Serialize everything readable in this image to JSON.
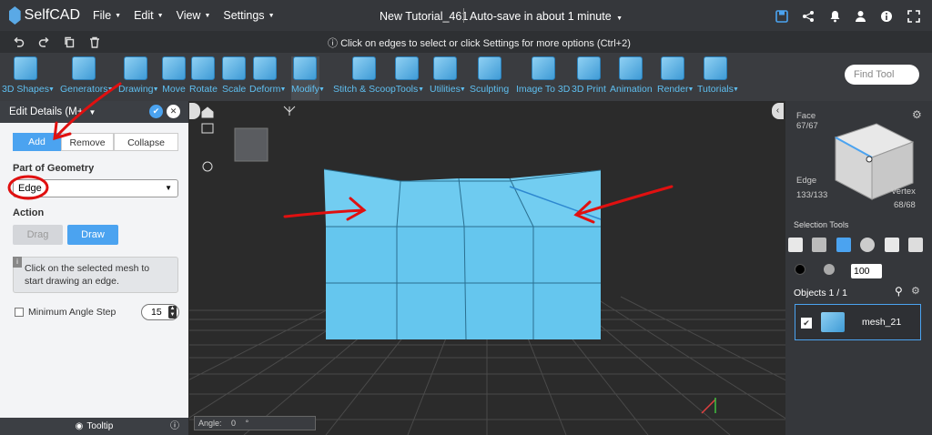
{
  "app": {
    "name": "SelfCAD",
    "brand_color": "#5aa9e6"
  },
  "menu": {
    "file": "File",
    "edit": "Edit",
    "view": "View",
    "settings": "Settings"
  },
  "document": {
    "title": "New Tutorial_461",
    "autosave": "Auto-save in about 1 minute"
  },
  "hint": "Click on edges to select or click Settings for more options (Ctrl+2)",
  "toolbar": [
    {
      "label": "3D Shapes"
    },
    {
      "label": "Generators"
    },
    {
      "label": "Drawing"
    },
    {
      "label": "Move"
    },
    {
      "label": "Rotate"
    },
    {
      "label": "Scale"
    },
    {
      "label": "Deform"
    },
    {
      "label": "Modify"
    },
    {
      "label": "Stitch & Scoop"
    },
    {
      "label": "Tools"
    },
    {
      "label": "Utilities"
    },
    {
      "label": "Sculpting"
    },
    {
      "label": "Image To 3D"
    },
    {
      "label": "3D Print"
    },
    {
      "label": "Animation"
    },
    {
      "label": "Render"
    },
    {
      "label": "Tutorials"
    }
  ],
  "search": {
    "placeholder": "Find Tool"
  },
  "left_panel": {
    "title": "Edit Details (M+",
    "modes": {
      "add": "Add",
      "remove": "Remove",
      "collapse": "Collapse"
    },
    "part_label": "Part of Geometry",
    "part_value": "Edge",
    "action_label": "Action",
    "drag": "Drag",
    "draw": "Draw",
    "info": "Click on the selected mesh to start drawing an edge.",
    "min_angle_label": "Minimum Angle Step",
    "min_angle_value": "15",
    "tooltip": "Tooltip"
  },
  "viewport": {
    "angle_label": "Angle:",
    "angle_value": "0",
    "angle_unit": "°"
  },
  "right_panel": {
    "face_label": "Face",
    "face_count": "67/67",
    "edge_label": "Edge",
    "edge_count": "133/133",
    "vertex_label": "Vertex",
    "vertex_count": "68/68",
    "selection_tools": "Selection Tools",
    "brush_size": "100",
    "objects_label": "Objects 1 / 1",
    "object_name": "mesh_21"
  },
  "colors": {
    "accent": "#4ba3f0",
    "mesh": "#5cc0ea",
    "annotation": "#e01010"
  }
}
